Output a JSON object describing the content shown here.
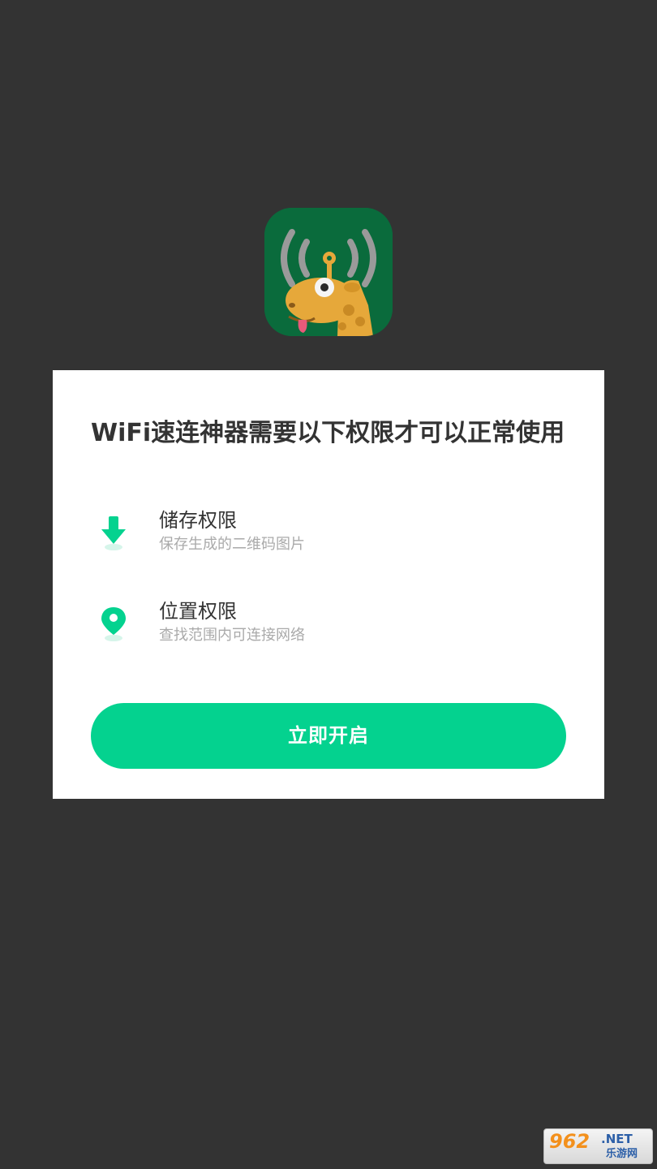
{
  "dialog": {
    "title": "WiFi速连神器需要以下权限才可以正常使用",
    "permissions": [
      {
        "name": "储存权限",
        "desc": "保存生成的二维码图片",
        "icon": "download-icon"
      },
      {
        "name": "位置权限",
        "desc": "查找范围内可连接网络",
        "icon": "location-pin-icon"
      }
    ],
    "button_label": "立即开启"
  },
  "app_icon": {
    "icon": "giraffe-wifi-app-icon"
  },
  "watermark": {
    "digits": "962",
    "net": ".NET",
    "site": "乐游网"
  },
  "colors": {
    "background": "#333333",
    "accent": "#04d28f",
    "app_icon_bg": "#0a6b3c"
  }
}
